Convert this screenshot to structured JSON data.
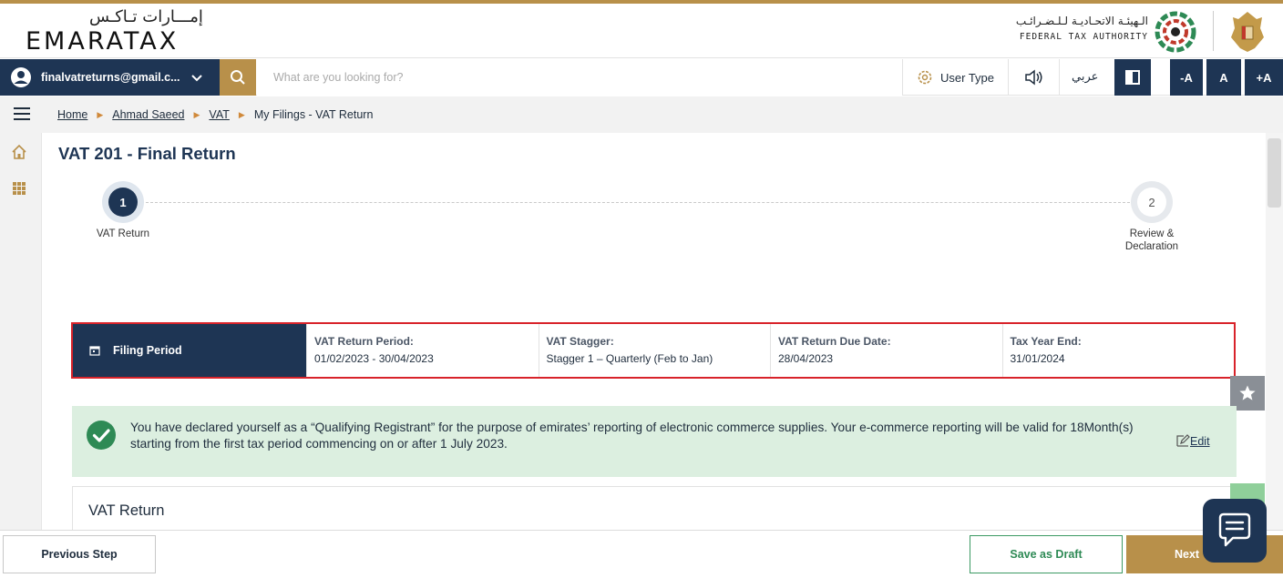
{
  "header": {
    "logo_ar": "إمـــارات تـاكـس",
    "logo_en": "EMARATAX",
    "authority_ar": "الـهيئـة الاتحـاديـة لـلـضـرائـب",
    "authority_en": "FEDERAL TAX AUTHORITY"
  },
  "navbar": {
    "user_email": "finalvatreturns@gmail.c...",
    "search_placeholder": "What are you looking for?",
    "user_type_label": "User Type",
    "language_label": "عربي",
    "font_decrease": "-A",
    "font_normal": "A",
    "font_increase": "+A"
  },
  "breadcrumb": {
    "items": [
      "Home",
      "Ahmad Saeed",
      "VAT"
    ],
    "current": "My Filings - VAT Return"
  },
  "page": {
    "title": "VAT 201 - Final Return"
  },
  "stepper": {
    "steps": [
      {
        "number": "1",
        "label": "VAT Return",
        "active": true
      },
      {
        "number": "2",
        "label_line1": "Review &",
        "label_line2": "Declaration",
        "active": false
      }
    ]
  },
  "filing_period": {
    "heading": "Filing Period",
    "fields": [
      {
        "label": "VAT Return Period:",
        "value": "01/02/2023 - 30/04/2023"
      },
      {
        "label": "VAT Stagger:",
        "value": "Stagger 1 – Quarterly (Feb to Jan)"
      },
      {
        "label": "VAT Return Due Date:",
        "value": "28/04/2023"
      },
      {
        "label": "Tax Year End:",
        "value": "31/01/2024"
      }
    ]
  },
  "notice": {
    "text": "You have declared yourself as a “Qualifying Registrant” for the purpose of emirates’ reporting of electronic commerce supplies. Your e-commerce reporting will be valid for 18Month(s) starting from the first tax period commencing on or after 1 July 2023.",
    "edit_label": "Edit"
  },
  "section": {
    "title": "VAT Return"
  },
  "footer": {
    "previous_label": "Previous Step",
    "draft_label": "Save as Draft",
    "next_label": "Next"
  },
  "colors": {
    "navy": "#1e3554",
    "gold": "#b8904a",
    "highlight_border": "#d8232a",
    "notice_bg": "#dcefe0",
    "success_green": "#2e8a55"
  },
  "icons": [
    "user-avatar-icon",
    "chevron-down-icon",
    "search-icon",
    "gear-icon",
    "speaker-icon",
    "contrast-icon",
    "menu-icon",
    "home-icon",
    "grid-icon",
    "calendar-icon",
    "star-icon",
    "check-circle-icon",
    "edit-icon",
    "chat-icon"
  ]
}
